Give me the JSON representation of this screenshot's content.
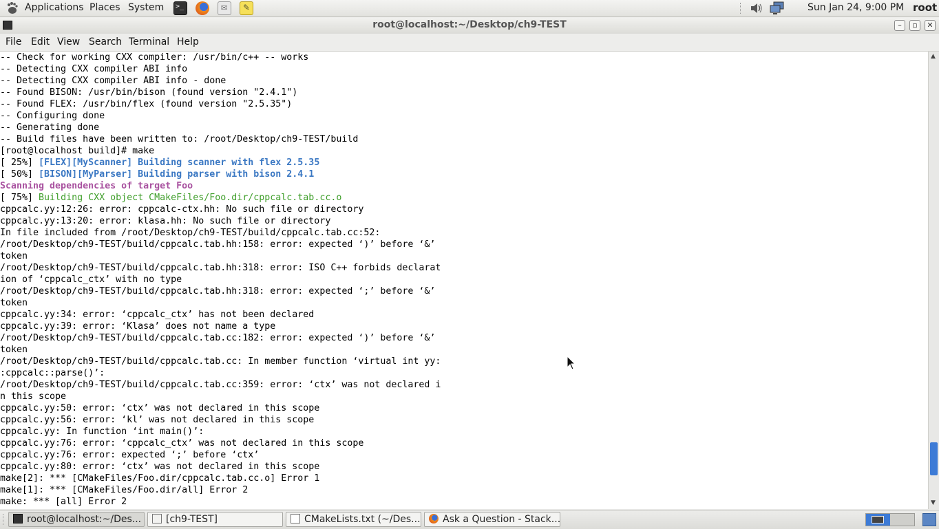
{
  "top_panel": {
    "menus": [
      "Applications",
      "Places",
      "System"
    ],
    "launchers": [
      "terminal-icon",
      "firefox-icon",
      "mail-icon",
      "notes-icon"
    ],
    "clock": "Sun Jan 24,  9:00 PM",
    "user": "root"
  },
  "window": {
    "title": "root@localhost:~/Desktop/ch9-TEST",
    "controls": [
      "minimize",
      "maximize",
      "close"
    ]
  },
  "menubar": [
    "File",
    "Edit",
    "View",
    "Search",
    "Terminal",
    "Help"
  ],
  "terminal": {
    "lines": [
      {
        "text": "-- Check for working CXX compiler: /usr/bin/c++ -- works",
        "style": ""
      },
      {
        "text": "-- Detecting CXX compiler ABI info",
        "style": ""
      },
      {
        "text": "-- Detecting CXX compiler ABI info - done",
        "style": ""
      },
      {
        "text": "-- Found BISON: /usr/bin/bison (found version \"2.4.1\")",
        "style": ""
      },
      {
        "text": "-- Found FLEX: /usr/bin/flex (found version \"2.5.35\")",
        "style": ""
      },
      {
        "text": "-- Configuring done",
        "style": ""
      },
      {
        "text": "-- Generating done",
        "style": ""
      },
      {
        "text": "-- Build files have been written to: /root/Desktop/ch9-TEST/build",
        "style": ""
      },
      {
        "text": "[root@localhost build]# make",
        "style": ""
      },
      {
        "prefix": "[ 25%] ",
        "text": "[FLEX][MyScanner] Building scanner with flex 2.5.35",
        "style": "blue"
      },
      {
        "prefix": "[ 50%] ",
        "text": "[BISON][MyParser] Building parser with bison 2.4.1",
        "style": "blue"
      },
      {
        "text": "Scanning dependencies of target Foo",
        "style": "magenta"
      },
      {
        "prefix": "[ 75%] ",
        "text": "Building CXX object CMakeFiles/Foo.dir/cppcalc.tab.cc.o",
        "style": "green"
      },
      {
        "text": "cppcalc.yy:12:26: error: cppcalc-ctx.hh: No such file or directory",
        "style": ""
      },
      {
        "text": "cppcalc.yy:13:20: error: klasa.hh: No such file or directory",
        "style": ""
      },
      {
        "text": "In file included from /root/Desktop/ch9-TEST/build/cppcalc.tab.cc:52:",
        "style": ""
      },
      {
        "text": "/root/Desktop/ch9-TEST/build/cppcalc.tab.hh:158: error: expected ‘)’ before ‘&’",
        "style": ""
      },
      {
        "text": "token",
        "style": ""
      },
      {
        "text": "/root/Desktop/ch9-TEST/build/cppcalc.tab.hh:318: error: ISO C++ forbids declarat",
        "style": ""
      },
      {
        "text": "ion of ‘cppcalc_ctx’ with no type",
        "style": ""
      },
      {
        "text": "/root/Desktop/ch9-TEST/build/cppcalc.tab.hh:318: error: expected ‘;’ before ‘&’",
        "style": ""
      },
      {
        "text": "token",
        "style": ""
      },
      {
        "text": "cppcalc.yy:34: error: ‘cppcalc_ctx’ has not been declared",
        "style": ""
      },
      {
        "text": "cppcalc.yy:39: error: ‘Klasa’ does not name a type",
        "style": ""
      },
      {
        "text": "/root/Desktop/ch9-TEST/build/cppcalc.tab.cc:182: error: expected ‘)’ before ‘&’",
        "style": ""
      },
      {
        "text": "token",
        "style": ""
      },
      {
        "text": "/root/Desktop/ch9-TEST/build/cppcalc.tab.cc: In member function ‘virtual int yy:",
        "style": ""
      },
      {
        "text": ":cppcalc::parse()’:",
        "style": ""
      },
      {
        "text": "/root/Desktop/ch9-TEST/build/cppcalc.tab.cc:359: error: ‘ctx’ was not declared i",
        "style": ""
      },
      {
        "text": "n this scope",
        "style": ""
      },
      {
        "text": "cppcalc.yy:50: error: ‘ctx’ was not declared in this scope",
        "style": ""
      },
      {
        "text": "cppcalc.yy:56: error: ‘kl’ was not declared in this scope",
        "style": ""
      },
      {
        "text": "cppcalc.yy: In function ‘int main()’:",
        "style": ""
      },
      {
        "text": "cppcalc.yy:76: error: ‘cppcalc_ctx’ was not declared in this scope",
        "style": ""
      },
      {
        "text": "cppcalc.yy:76: error: expected ‘;’ before ‘ctx’",
        "style": ""
      },
      {
        "text": "cppcalc.yy:80: error: ‘ctx’ was not declared in this scope",
        "style": ""
      },
      {
        "text": "make[2]: *** [CMakeFiles/Foo.dir/cppcalc.tab.cc.o] Error 1",
        "style": ""
      },
      {
        "text": "make[1]: *** [CMakeFiles/Foo.dir/all] Error 2",
        "style": ""
      },
      {
        "text": "make: *** [all] Error 2",
        "style": ""
      }
    ]
  },
  "taskbar": [
    {
      "label": "root@localhost:~/Des...",
      "icon": "terminal-icon",
      "active": true
    },
    {
      "label": "[ch9-TEST]",
      "icon": "folder-icon",
      "active": false
    },
    {
      "label": "CMakeLists.txt (~/Des...",
      "icon": "text-editor-icon",
      "active": false
    },
    {
      "label": "Ask a Question - Stack...",
      "icon": "firefox-icon",
      "active": false
    }
  ],
  "colors": {
    "term_blue": "#3b78c3",
    "term_magenta": "#a8519f",
    "term_green": "#3f9e2a",
    "scroll_thumb": "#3d7bd6"
  }
}
